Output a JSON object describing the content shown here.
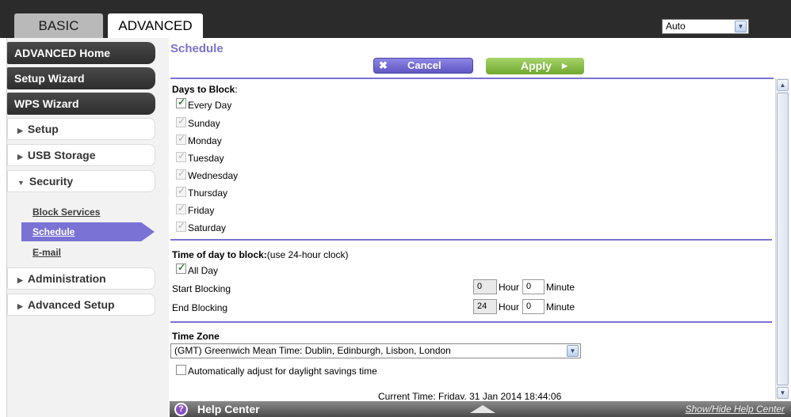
{
  "tabs": {
    "basic": "BASIC",
    "advanced": "ADVANCED"
  },
  "language": {
    "selected": "Auto"
  },
  "sidebar": {
    "advanced_home": "ADVANCED Home",
    "setup_wizard": "Setup Wizard",
    "wps_wizard": "WPS Wizard",
    "setup": "Setup",
    "usb_storage": "USB Storage",
    "security": "Security",
    "security_sub": {
      "block_services": "Block Services",
      "schedule": "Schedule",
      "email": "E-mail"
    },
    "administration": "Administration",
    "advanced_setup": "Advanced Setup"
  },
  "page": {
    "title": "Schedule",
    "cancel_label": "Cancel",
    "apply_label": "Apply"
  },
  "days": {
    "heading": "Days to Block",
    "heading_suffix": ":",
    "every_day": "Every Day",
    "every_day_checked": true,
    "list": [
      "Sunday",
      "Monday",
      "Tuesday",
      "Wednesday",
      "Thursday",
      "Friday",
      "Saturday"
    ]
  },
  "time": {
    "heading": "Time of day to block:",
    "heading_note": "(use 24-hour clock)",
    "all_day": "All Day",
    "all_day_checked": true,
    "start_label": "Start Blocking",
    "end_label": "End Blocking",
    "hour_label": "Hour",
    "minute_label": "Minute",
    "start_hour": "0",
    "start_minute": "0",
    "end_hour": "24",
    "end_minute": "0"
  },
  "timezone": {
    "heading": "Time Zone",
    "selected": "(GMT) Greenwich Mean Time: Dublin, Edinburgh, Lisbon, London",
    "dst_label": "Automatically adjust for daylight savings time",
    "dst_checked": false,
    "current_time": "Current Time: Friday, 31 Jan 2014 18:44:06"
  },
  "help": {
    "label": "Help Center",
    "toggle": "Show/Hide Help Center"
  }
}
